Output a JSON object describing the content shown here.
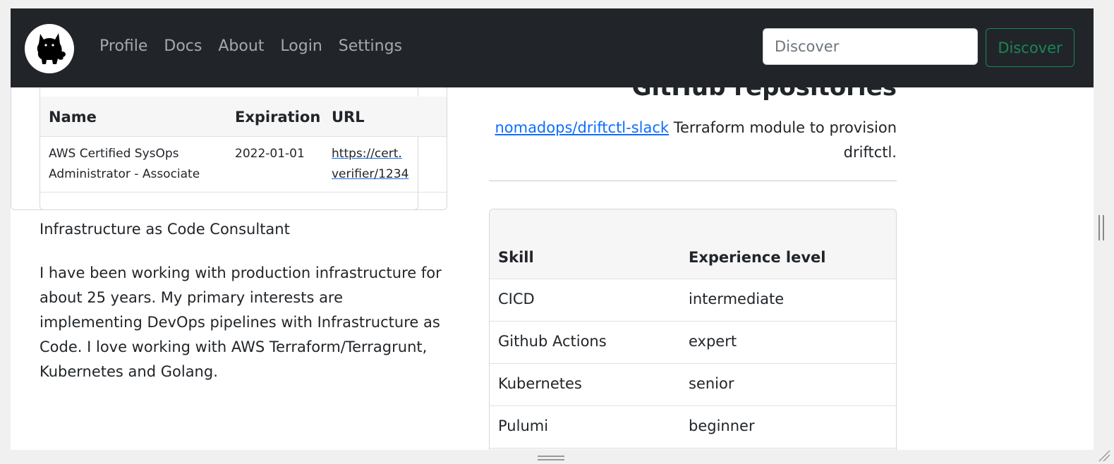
{
  "navbar": {
    "links": [
      "Profile",
      "Docs",
      "About",
      "Login",
      "Settings"
    ],
    "search": {
      "placeholder": "Discover",
      "button_label": "Discover"
    }
  },
  "certifications": {
    "headers": [
      "Name",
      "Expiration",
      "URL"
    ],
    "rows": [
      {
        "name_line1": "AWS Certified SysOps",
        "name_line2": "Administrator - Associate",
        "expiration": "2022-01-01",
        "url_line1": "https://cert.",
        "url_line2": "verifier/1234"
      }
    ]
  },
  "profile": {
    "job_title": "Infrastructure as Code Consultant",
    "bio": "I have been working with production infrastructure for about 25 years. My primary interests are implementing DevOps pipelines with Infrastructure as Code. I love working with AWS Terraform/Terragrunt, Kubernetes and Golang."
  },
  "repositories": {
    "heading": "GitHub repositories",
    "items": [
      {
        "name": "nomadops/driftctl-slack",
        "description_line1": " Terraform module to provision",
        "description_line2": "driftctl."
      }
    ]
  },
  "skills": {
    "headers": [
      "Skill",
      "Experience level"
    ],
    "rows": [
      {
        "skill": "CICD",
        "level": "intermediate"
      },
      {
        "skill": "Github Actions",
        "level": "expert"
      },
      {
        "skill": "Kubernetes",
        "level": "senior"
      },
      {
        "skill": "Pulumi",
        "level": "beginner"
      }
    ]
  },
  "colors": {
    "navbar_bg": "#212529",
    "link": "#0d6efd",
    "discover_button": "#198754"
  }
}
